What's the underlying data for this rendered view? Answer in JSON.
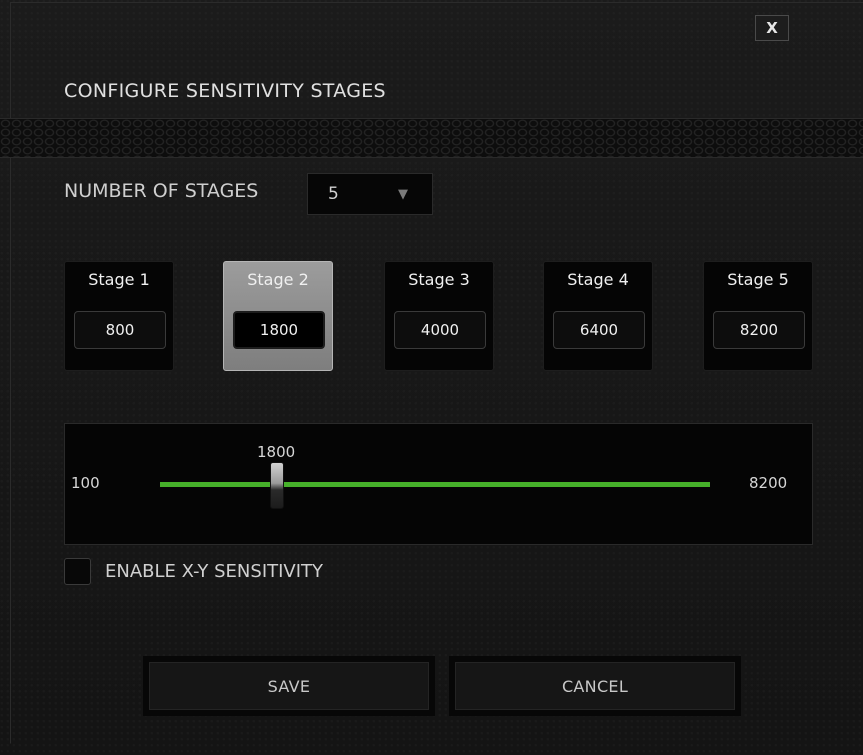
{
  "dialog": {
    "title": "CONFIGURE SENSITIVITY STAGES",
    "close_label": "X"
  },
  "stages_count": {
    "label": "NUMBER OF STAGES",
    "selected": "5"
  },
  "stages": [
    {
      "label": "Stage 1",
      "value": "800"
    },
    {
      "label": "Stage 2",
      "value": "1800"
    },
    {
      "label": "Stage 3",
      "value": "4000"
    },
    {
      "label": "Stage 4",
      "value": "6400"
    },
    {
      "label": "Stage 5",
      "value": "8200"
    }
  ],
  "selected_stage_index": 1,
  "slider": {
    "min": "100",
    "max": "8200",
    "current": "1800",
    "track_color": "#46b02a"
  },
  "xy_sensitivity": {
    "label": "ENABLE X-Y SENSITIVITY",
    "checked": false
  },
  "buttons": {
    "save": "SAVE",
    "cancel": "CANCEL"
  },
  "icons": {
    "dropdown": "triangle-down-icon",
    "close": "close-icon"
  }
}
